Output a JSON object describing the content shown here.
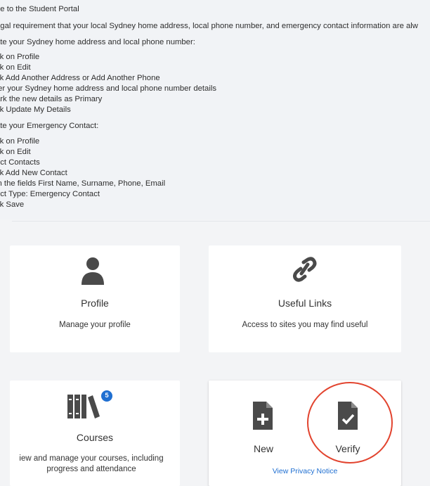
{
  "notice": {
    "lines": [
      "ne to the Student Portal",
      "egal requirement that your local Sydney home address, local phone number, and emergency contact information are alw",
      "ate your Sydney home address and local phone number:",
      "ck on Profile",
      "ck on Edit",
      "ck Add Another Address or Add Another Phone",
      "ter your Sydney home address and local phone number details",
      "ark the new details as Primary",
      "ck Update My Details",
      "ate your Emergency Contact:",
      "ck on Profile",
      "ck on Edit",
      "ect Contacts",
      "ck Add New Contact",
      "in the fields First Name, Surname, Phone, Email",
      "ect Type: Emergency Contact",
      "ck Save"
    ]
  },
  "cards": {
    "profile": {
      "title": "Profile",
      "description": "Manage your profile",
      "icon": "user-icon"
    },
    "useful_links": {
      "title": "Useful Links",
      "description": "Access to sites you may find useful",
      "icon": "link-icon"
    },
    "courses": {
      "title": "Courses",
      "description_line1": "iew and manage your courses, including",
      "description_line2": "progress and attendance",
      "badge": "5",
      "icon": "books-icon"
    },
    "declaration": {
      "new_label": "New",
      "verify_label": "Verify",
      "privacy_link": "View Privacy Notice",
      "new_icon": "file-plus-icon",
      "verify_icon": "file-check-icon"
    }
  },
  "colors": {
    "background": "#f3f4f6",
    "card": "#ffffff",
    "icon": "#4a4a4a",
    "link": "#1f6fd1",
    "highlight": "#e2442f"
  }
}
